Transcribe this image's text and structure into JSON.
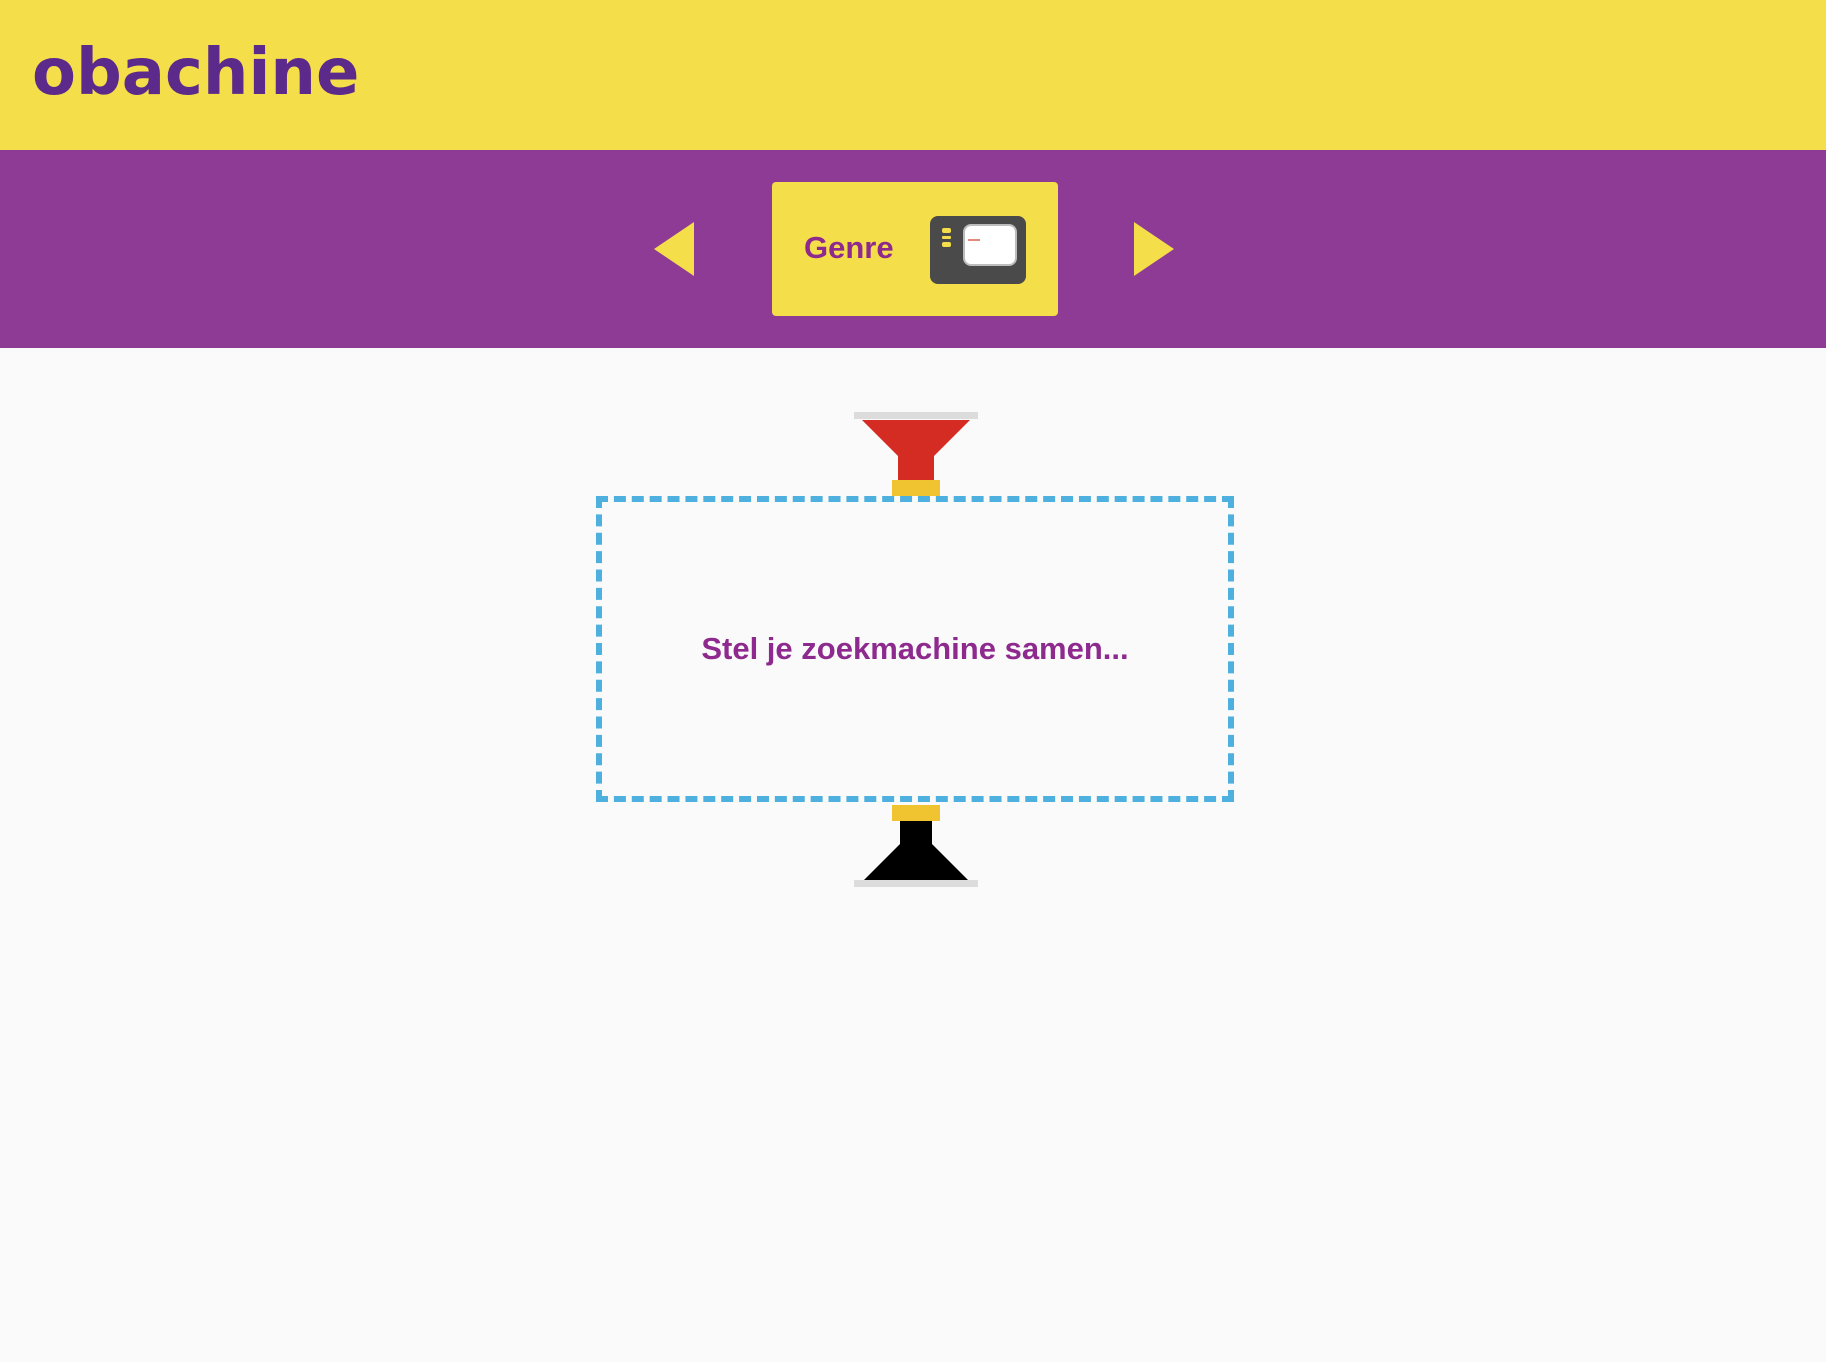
{
  "header": {
    "logo_text": "obachine",
    "background_color": "#f4de4a",
    "logo_color": "#5b2a8a"
  },
  "navbar": {
    "background_color": "#8e3b96",
    "prev_icon": "triangle-left-icon",
    "next_icon": "triangle-right-icon",
    "current_item": {
      "label": "Genre",
      "icon": "genre-card-icon"
    }
  },
  "machine": {
    "input_funnel_icon": "red-funnel-icon",
    "output_funnel_icon": "black-funnel-icon",
    "dropzone_text": "Stel je zoekmachine samen...",
    "dropzone_border_color": "#4db0de",
    "text_color": "#8e2a8e"
  }
}
